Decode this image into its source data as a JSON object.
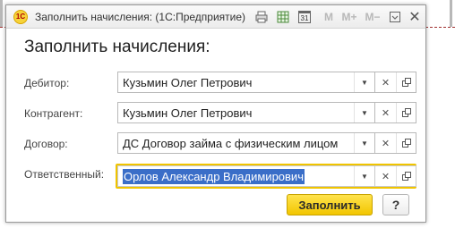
{
  "window": {
    "title": "Заполнить начисления: (1С:Предприятие)",
    "logo_text": "1С",
    "toolbar": {
      "m": "M",
      "m_plus": "M+",
      "m_minus": "M−",
      "calendar_day": "31"
    }
  },
  "form": {
    "heading": "Заполнить начисления:",
    "fields": [
      {
        "label": "Дебитор:",
        "value": "Кузьмин Олег Петрович"
      },
      {
        "label": "Контрагент:",
        "value": "Кузьмин Олег Петрович"
      },
      {
        "label": "Договор:",
        "value": "ДС Договор займа с физическим лицом"
      },
      {
        "label": "Ответственный:",
        "value": "Орлов Александр Владимирович"
      }
    ]
  },
  "buttons": {
    "fill": "Заполнить",
    "help": "?"
  },
  "colors": {
    "accent_yellow": "#f2c600",
    "selection": "#3a6ec8"
  }
}
